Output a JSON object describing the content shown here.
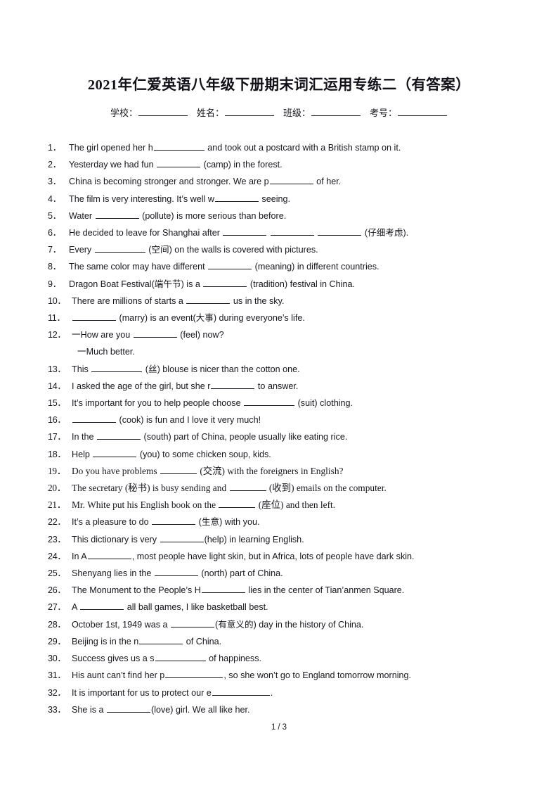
{
  "title": "2021年仁爱英语八年级下册期末词汇运用专练二（有答案）",
  "info_fields": [
    {
      "label": "学校："
    },
    {
      "label": "姓名："
    },
    {
      "label": "班级："
    },
    {
      "label": "考号："
    }
  ],
  "questions": [
    {
      "num": "1．",
      "parts": [
        {
          "t": "text",
          "v": "The girl opened her h"
        },
        {
          "t": "blank",
          "w": "b-lg"
        },
        {
          "t": "text",
          "v": " and took out a postcard with a British stamp on it."
        }
      ]
    },
    {
      "num": "2．",
      "parts": [
        {
          "t": "text",
          "v": "Yesterday we had fun "
        },
        {
          "t": "blank",
          "w": "b-md"
        },
        {
          "t": "text",
          "v": " (camp) in the forest."
        }
      ]
    },
    {
      "num": "3．",
      "parts": [
        {
          "t": "text",
          "v": "China is becoming stronger and stronger. We are p"
        },
        {
          "t": "blank",
          "w": "b-md"
        },
        {
          "t": "text",
          "v": " of her."
        }
      ]
    },
    {
      "num": "4．",
      "parts": [
        {
          "t": "text",
          "v": "The film is very interesting. It’s well w"
        },
        {
          "t": "blank",
          "w": "b-md"
        },
        {
          "t": "text",
          "v": " seeing."
        }
      ]
    },
    {
      "num": "5．",
      "parts": [
        {
          "t": "text",
          "v": "Water "
        },
        {
          "t": "blank",
          "w": "b-md"
        },
        {
          "t": "text",
          "v": " (pollute) is more serious than before."
        }
      ]
    },
    {
      "num": "6．",
      "parts": [
        {
          "t": "text",
          "v": "He decided to leave for Shanghai after "
        },
        {
          "t": "blank",
          "w": "b-md"
        },
        {
          "t": "text",
          "v": " "
        },
        {
          "t": "blank",
          "w": "b-md"
        },
        {
          "t": "text",
          "v": " "
        },
        {
          "t": "blank",
          "w": "b-md"
        },
        {
          "t": "text",
          "v": " (仔细考虑)."
        }
      ]
    },
    {
      "num": "7．",
      "parts": [
        {
          "t": "text",
          "v": "Every "
        },
        {
          "t": "blank",
          "w": "b-lg"
        },
        {
          "t": "text",
          "v": " (空间) on the walls is covered with pictures."
        }
      ]
    },
    {
      "num": "8．",
      "parts": [
        {
          "t": "text",
          "v": "The same color may have different "
        },
        {
          "t": "blank",
          "w": "b-md"
        },
        {
          "t": "text",
          "v": " (meaning) in different countries."
        }
      ]
    },
    {
      "num": "9．",
      "parts": [
        {
          "t": "text",
          "v": "Dragon Boat Festival(端午节) is a "
        },
        {
          "t": "blank",
          "w": "b-md"
        },
        {
          "t": "text",
          "v": " (tradition) festival in China."
        }
      ]
    },
    {
      "num": "10．",
      "wide": true,
      "parts": [
        {
          "t": "text",
          "v": "There are millions of starts a "
        },
        {
          "t": "blank",
          "w": "b-md"
        },
        {
          "t": "text",
          "v": " us in the sky."
        }
      ]
    },
    {
      "num": "11．",
      "wide": true,
      "parts": [
        {
          "t": "text",
          "v": " "
        },
        {
          "t": "blank",
          "w": "b-md"
        },
        {
          "t": "text",
          "v": " (marry) is an event(大事) during everyone’s life."
        }
      ]
    },
    {
      "num": "12．",
      "wide": true,
      "parts": [
        {
          "t": "text",
          "v": "一How are you "
        },
        {
          "t": "blank",
          "w": "b-md"
        },
        {
          "t": "text",
          "v": " (feel) now?"
        }
      ]
    },
    {
      "num": "",
      "cont": true,
      "parts": [
        {
          "t": "text",
          "v": "一Much better."
        }
      ]
    },
    {
      "num": "13．",
      "wide": true,
      "parts": [
        {
          "t": "text",
          "v": "This "
        },
        {
          "t": "blank",
          "w": "b-lg"
        },
        {
          "t": "text",
          "v": " (丝) blouse is nicer than the cotton one."
        }
      ]
    },
    {
      "num": "14．",
      "wide": true,
      "parts": [
        {
          "t": "text",
          "v": "I asked the age of the girl, but she r"
        },
        {
          "t": "blank",
          "w": "b-md"
        },
        {
          "t": "text",
          "v": " to answer."
        }
      ]
    },
    {
      "num": "15．",
      "wide": true,
      "parts": [
        {
          "t": "text",
          "v": "It’s important for you to help people choose "
        },
        {
          "t": "blank",
          "w": "b-lg"
        },
        {
          "t": "text",
          "v": " (suit) clothing."
        }
      ]
    },
    {
      "num": "16．",
      "wide": true,
      "parts": [
        {
          "t": "text",
          "v": " "
        },
        {
          "t": "blank",
          "w": "b-md"
        },
        {
          "t": "text",
          "v": " (cook) is fun and I love it very much!"
        }
      ]
    },
    {
      "num": "17．",
      "wide": true,
      "parts": [
        {
          "t": "text",
          "v": "In the "
        },
        {
          "t": "blank",
          "w": "b-md"
        },
        {
          "t": "text",
          "v": " (south) part of China, people usually like eating rice."
        }
      ]
    },
    {
      "num": "18．",
      "wide": true,
      "parts": [
        {
          "t": "text",
          "v": "Help "
        },
        {
          "t": "blank",
          "w": "b-md"
        },
        {
          "t": "text",
          "v": " (you) to some chicken soup, kids."
        }
      ]
    },
    {
      "num": "19．",
      "wide": true,
      "serif": true,
      "parts": [
        {
          "t": "text",
          "v": "Do you have problems "
        },
        {
          "t": "blank",
          "w": "b-sm"
        },
        {
          "t": "text",
          "v": " (交流) with the foreigners in English?"
        }
      ]
    },
    {
      "num": "20．",
      "wide": true,
      "serif": true,
      "parts": [
        {
          "t": "text",
          "v": "The secretary (秘书) is busy sending and "
        },
        {
          "t": "blank",
          "w": "b-sm"
        },
        {
          "t": "text",
          "v": " (收到) emails on the computer."
        }
      ]
    },
    {
      "num": "21．",
      "wide": true,
      "serif": true,
      "parts": [
        {
          "t": "text",
          "v": "Mr. White put his English book on the "
        },
        {
          "t": "blank",
          "w": "b-sm"
        },
        {
          "t": "text",
          "v": " (座位) and then left."
        }
      ]
    },
    {
      "num": "22．",
      "wide": true,
      "parts": [
        {
          "t": "text",
          "v": "It’s a pleasure to do "
        },
        {
          "t": "blank",
          "w": "b-md"
        },
        {
          "t": "text",
          "v": " (生意) with you."
        }
      ]
    },
    {
      "num": "23．",
      "wide": true,
      "parts": [
        {
          "t": "text",
          "v": "This dictionary is very "
        },
        {
          "t": "blank",
          "w": "b-md"
        },
        {
          "t": "text",
          "v": "(help) in learning English."
        }
      ]
    },
    {
      "num": "24．",
      "wide": true,
      "parts": [
        {
          "t": "text",
          "v": "In A"
        },
        {
          "t": "blank",
          "w": "b-md"
        },
        {
          "t": "text",
          "v": ", most people have light skin, but in Africa, lots of people have dark skin."
        }
      ]
    },
    {
      "num": "25．",
      "wide": true,
      "parts": [
        {
          "t": "text",
          "v": "Shenyang lies in the "
        },
        {
          "t": "blank",
          "w": "b-md"
        },
        {
          "t": "text",
          "v": " (north) part of China."
        }
      ]
    },
    {
      "num": "26．",
      "wide": true,
      "parts": [
        {
          "t": "text",
          "v": "The Monument to the People’s H"
        },
        {
          "t": "blank",
          "w": "b-md"
        },
        {
          "t": "text",
          "v": " lies in the center of Tian’anmen Square."
        }
      ]
    },
    {
      "num": "27．",
      "wide": true,
      "parts": [
        {
          "t": "text",
          "v": "A "
        },
        {
          "t": "blank",
          "w": "b-md"
        },
        {
          "t": "text",
          "v": " all ball games, I like basketball best."
        }
      ]
    },
    {
      "num": "28．",
      "wide": true,
      "parts": [
        {
          "t": "text",
          "v": "October 1st, 1949 was a "
        },
        {
          "t": "blank",
          "w": "b-md"
        },
        {
          "t": "text",
          "v": "(有意义的) day in the history of China."
        }
      ]
    },
    {
      "num": "29．",
      "wide": true,
      "parts": [
        {
          "t": "text",
          "v": "Beijing is in the n"
        },
        {
          "t": "blank",
          "w": "b-md"
        },
        {
          "t": "text",
          "v": " of China."
        }
      ]
    },
    {
      "num": "30．",
      "wide": true,
      "parts": [
        {
          "t": "text",
          "v": "Success gives us a s"
        },
        {
          "t": "blank",
          "w": "b-lg"
        },
        {
          "t": "text",
          "v": " of happiness."
        }
      ]
    },
    {
      "num": "31．",
      "wide": true,
      "parts": [
        {
          "t": "text",
          "v": "His aunt can’t find her p"
        },
        {
          "t": "blank",
          "w": "b-xl"
        },
        {
          "t": "text",
          "v": ", so she won’t go to England tomorrow morning."
        }
      ]
    },
    {
      "num": "32．",
      "wide": true,
      "parts": [
        {
          "t": "text",
          "v": "It is important for us to protect our e"
        },
        {
          "t": "blank",
          "w": "b-xl"
        },
        {
          "t": "text",
          "v": "."
        }
      ]
    },
    {
      "num": "33．",
      "wide": true,
      "parts": [
        {
          "t": "text",
          "v": "She is a "
        },
        {
          "t": "blank",
          "w": "b-md"
        },
        {
          "t": "text",
          "v": "(love) girl. We all like her."
        }
      ]
    }
  ],
  "footer": {
    "current_page": "1",
    "separator": "/",
    "total_pages": "3"
  }
}
